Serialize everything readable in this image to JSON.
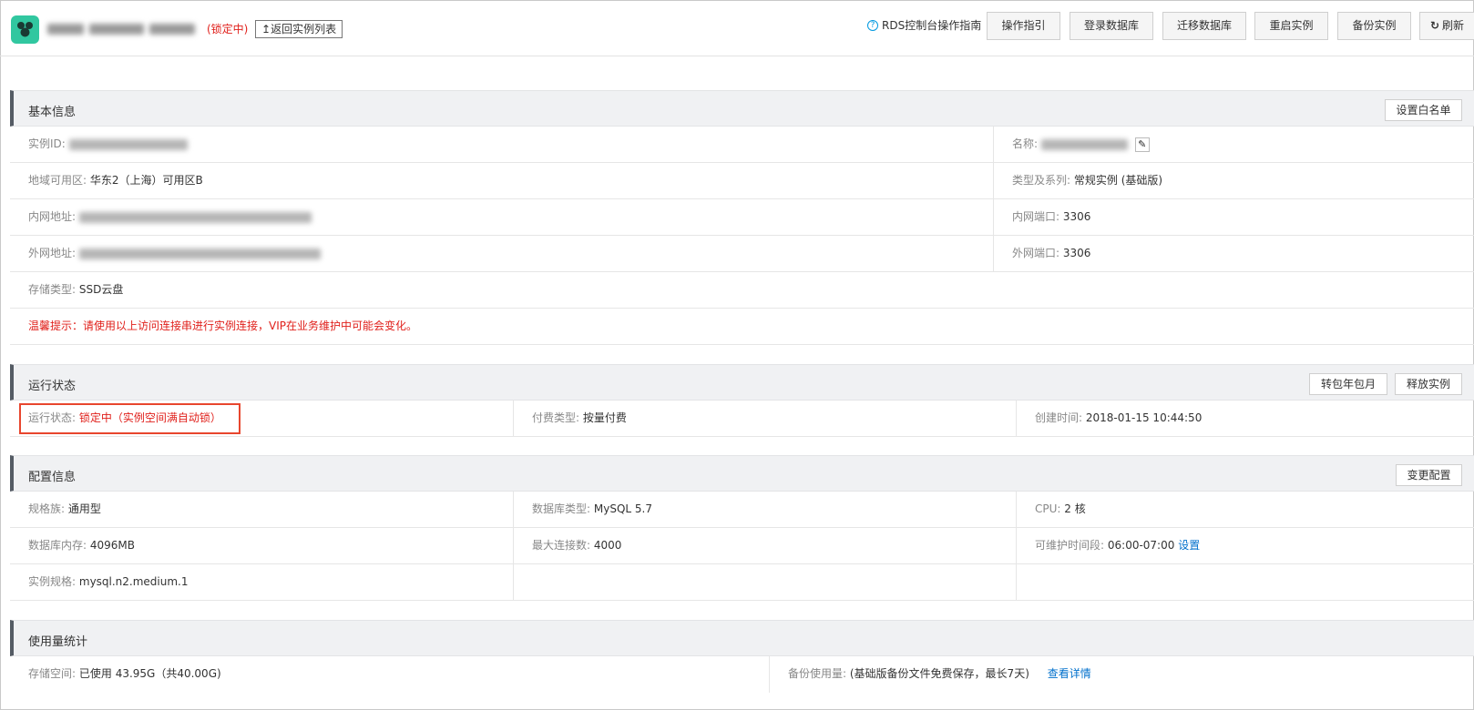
{
  "header": {
    "locked_tag": "(锁定中)",
    "back_button": "返回实例列表",
    "back_icon": "↥",
    "help_icon": "?",
    "guide_link": "RDS控制台操作指南",
    "buttons": [
      "操作指引",
      "登录数据库",
      "迁移数据库",
      "重启实例",
      "备份实例"
    ],
    "refresh_icon": "↻",
    "refresh_button": "刷新"
  },
  "basic_info": {
    "title": "基本信息",
    "whitelist_button": "设置白名单",
    "instance_id_label": "实例ID:",
    "name_label": "名称:",
    "edit_icon": "✎",
    "region_label": "地域可用区:",
    "region_value": "华东2（上海）可用区B",
    "type_label": "类型及系列:",
    "type_value": "常规实例 (基础版)",
    "intranet_label": "内网地址:",
    "intranet_port_label": "内网端口:",
    "intranet_port_value": "3306",
    "internet_label": "外网地址:",
    "internet_port_label": "外网端口:",
    "internet_port_value": "3306",
    "storage_label": "存储类型:",
    "storage_value": "SSD云盘",
    "tip": "温馨提示：请使用以上访问连接串进行实例连接，VIP在业务维护中可能会变化。"
  },
  "run_status": {
    "title": "运行状态",
    "convert_button": "转包年包月",
    "release_button": "释放实例",
    "status_label": "运行状态:",
    "status_value": "锁定中（实例空间满自动锁）",
    "billing_label": "付费类型:",
    "billing_value": "按量付费",
    "created_label": "创建时间:",
    "created_value": "2018-01-15 10:44:50"
  },
  "config": {
    "title": "配置信息",
    "change_button": "变更配置",
    "family_label": "规格族:",
    "family_value": "通用型",
    "db_type_label": "数据库类型:",
    "db_type_value": "MySQL 5.7",
    "cpu_label": "CPU:",
    "cpu_value": "2 核",
    "memory_label": "数据库内存:",
    "memory_value": "4096MB",
    "max_conn_label": "最大连接数:",
    "max_conn_value": "4000",
    "maint_label": "可维护时间段:",
    "maint_value": "06:00-07:00",
    "maint_link": "设置",
    "spec_label": "实例规格:",
    "spec_value": "mysql.n2.medium.1"
  },
  "usage": {
    "title": "使用量统计",
    "storage_label": "存储空间:",
    "storage_value": "已使用 43.95G（共40.00G)",
    "backup_label": "备份使用量:",
    "backup_value": "(基础版备份文件免费保存，最长7天)",
    "backup_link": "查看详情"
  },
  "colors": {
    "accent_red": "#e0201b",
    "link_blue": "#0070cc",
    "logo_green": "#31c7a0",
    "highlight_border": "#e8462e"
  }
}
